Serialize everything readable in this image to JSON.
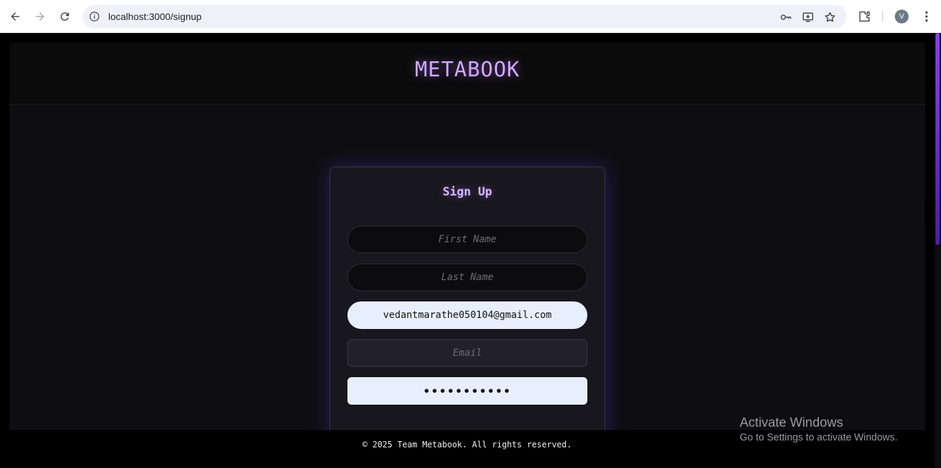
{
  "browser": {
    "url": "localhost:3000/signup",
    "profile_initial": "V"
  },
  "site": {
    "brand": "METABOOK"
  },
  "signup": {
    "title": "Sign Up",
    "first_name_placeholder": "First Name",
    "last_name_placeholder": "Last Name",
    "autofill_email_value": "vedantmarathe050104@gmail.com",
    "email_placeholder": "Email",
    "password_value": "•••••••••••"
  },
  "footer": {
    "text": "© 2025 Team Metabook. All rights reserved."
  },
  "os_watermark": {
    "title": "Activate Windows",
    "subtitle": "Go to Settings to activate Windows."
  },
  "colors": {
    "brand_purple": "#d1a8ff",
    "card_bg": "#18171d",
    "autofill_bg": "#e8effc",
    "scroll_accent": "#8a3ff0"
  }
}
